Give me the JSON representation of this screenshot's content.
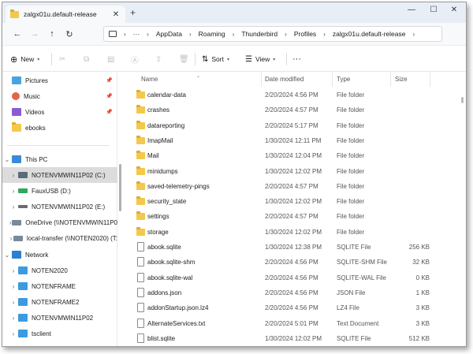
{
  "tab": {
    "title": "zalgx01u.default-release",
    "close": "✕",
    "new_tab": "+"
  },
  "window_controls": {
    "minimize": "—",
    "maximize": "☐",
    "close": "✕"
  },
  "address": {
    "more": "···",
    "crumbs": [
      "AppData",
      "Roaming",
      "Thunderbird",
      "Profiles",
      "zalgx01u.default-release"
    ],
    "separator": "›"
  },
  "commands": {
    "new": "New",
    "sort": "Sort",
    "view": "View",
    "more": "···"
  },
  "sidebar": {
    "quick": [
      {
        "label": "Pictures",
        "icon": "pictures-icon"
      },
      {
        "label": "Music",
        "icon": "music-icon"
      },
      {
        "label": "Videos",
        "icon": "videos-icon"
      },
      {
        "label": "ebooks",
        "icon": "folder-icon"
      }
    ],
    "this_pc": "This PC",
    "drives": [
      "NOTENVMWIN11P02 (C:)",
      "FauxUSB (D:)",
      "NOTENVMWIN11P02 (E:)",
      "OneDrive (\\\\NOTENVMWIN11P0",
      "local-transfer (\\\\NOTEN2020) (T:"
    ],
    "network": "Network",
    "network_items": [
      "NOTEN2020",
      "NOTENFRAME",
      "NOTENFRAME2",
      "NOTENVMWIN11P02",
      "tsclient"
    ]
  },
  "columns": {
    "name": "Name",
    "date": "Date modified",
    "type": "Type",
    "size": "Size"
  },
  "files": [
    {
      "name": "calendar-data",
      "date": "2/20/2024 4:56 PM",
      "type": "File folder",
      "size": "",
      "kind": "folder"
    },
    {
      "name": "crashes",
      "date": "2/20/2024 4:57 PM",
      "type": "File folder",
      "size": "",
      "kind": "folder"
    },
    {
      "name": "datareporting",
      "date": "2/20/2024 5:17 PM",
      "type": "File folder",
      "size": "",
      "kind": "folder"
    },
    {
      "name": "ImapMail",
      "date": "1/30/2024 12:11 PM",
      "type": "File folder",
      "size": "",
      "kind": "folder"
    },
    {
      "name": "Mail",
      "date": "1/30/2024 12:04 PM",
      "type": "File folder",
      "size": "",
      "kind": "folder"
    },
    {
      "name": "minidumps",
      "date": "1/30/2024 12:02 PM",
      "type": "File folder",
      "size": "",
      "kind": "folder"
    },
    {
      "name": "saved-telemetry-pings",
      "date": "2/20/2024 4:57 PM",
      "type": "File folder",
      "size": "",
      "kind": "folder"
    },
    {
      "name": "security_state",
      "date": "1/30/2024 12:02 PM",
      "type": "File folder",
      "size": "",
      "kind": "folder"
    },
    {
      "name": "settings",
      "date": "2/20/2024 4:57 PM",
      "type": "File folder",
      "size": "",
      "kind": "folder"
    },
    {
      "name": "storage",
      "date": "1/30/2024 12:02 PM",
      "type": "File folder",
      "size": "",
      "kind": "folder"
    },
    {
      "name": "abook.sqlite",
      "date": "1/30/2024 12:38 PM",
      "type": "SQLITE File",
      "size": "256 KB",
      "kind": "file"
    },
    {
      "name": "abook.sqlite-shm",
      "date": "2/20/2024 4:56 PM",
      "type": "SQLITE-SHM File",
      "size": "32 KB",
      "kind": "file"
    },
    {
      "name": "abook.sqlite-wal",
      "date": "2/20/2024 4:56 PM",
      "type": "SQLITE-WAL File",
      "size": "0 KB",
      "kind": "file"
    },
    {
      "name": "addons.json",
      "date": "2/20/2024 4:56 PM",
      "type": "JSON File",
      "size": "1 KB",
      "kind": "file"
    },
    {
      "name": "addonStartup.json.lz4",
      "date": "2/20/2024 4:56 PM",
      "type": "LZ4 File",
      "size": "3 KB",
      "kind": "file"
    },
    {
      "name": "AlternateServices.txt",
      "date": "2/20/2024 5:01 PM",
      "type": "Text Document",
      "size": "3 KB",
      "kind": "file"
    },
    {
      "name": "blist.sqlite",
      "date": "1/30/2024 12:02 PM",
      "type": "SQLITE File",
      "size": "512 KB",
      "kind": "file"
    }
  ]
}
